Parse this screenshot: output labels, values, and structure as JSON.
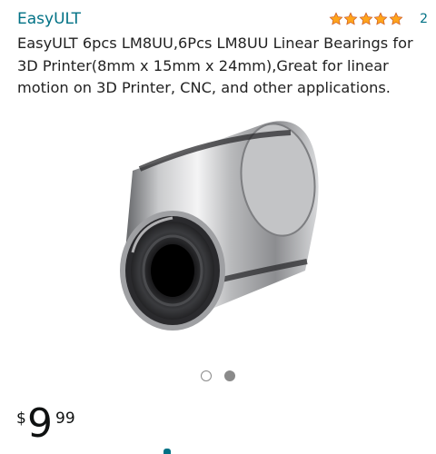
{
  "product": {
    "brand": "EasyULT",
    "title": "EasyULT 6pcs LM8UU,6Pcs LM8UU Linear Bearings for 3D Printer(8mm x 15mm x 24mm),Great for linear motion on 3D Printer, CNC, and other applications.",
    "rating": {
      "stars": 5,
      "count": "2",
      "star_color": "#FFA41C"
    },
    "image": {
      "icon": "linear-bearing-image",
      "alt": "LM8UU linear bearing"
    },
    "carousel": {
      "total": 2,
      "active_index": 1
    },
    "price": {
      "currency": "$",
      "whole": "9",
      "fraction": "99"
    }
  },
  "colors": {
    "link": "#007185",
    "text": "#222222",
    "dot": "#8a8a8a"
  }
}
